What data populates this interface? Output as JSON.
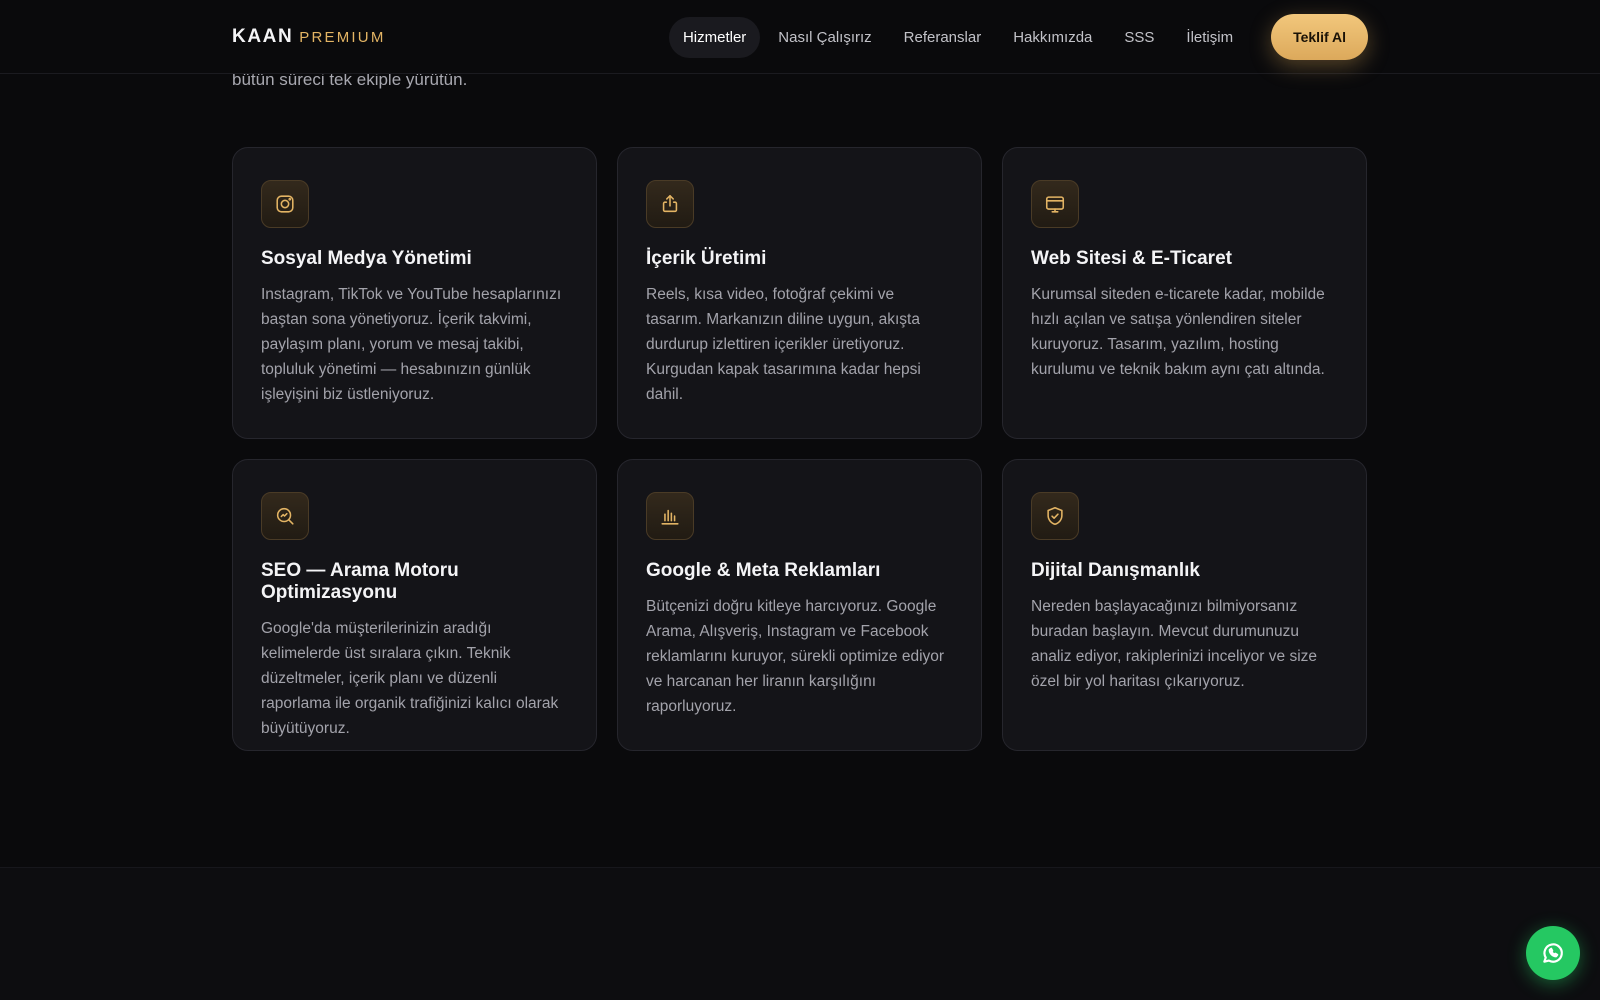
{
  "header": {
    "logo_main": "KAAN",
    "logo_accent": "PREMIUM",
    "nav": [
      {
        "label": "Hizmetler",
        "active": true
      },
      {
        "label": "Nasıl Çalışırız"
      },
      {
        "label": "Referanslar"
      },
      {
        "label": "Hakkımızda"
      },
      {
        "label": "SSS"
      },
      {
        "label": "İletişim"
      }
    ],
    "cta_label": "Teklif Al"
  },
  "intro_text": "bütün süreci tek ekiple yürütün.",
  "services": [
    {
      "icon": "instagram-icon",
      "title": "Sosyal Medya Yönetimi",
      "text": "Instagram, TikTok ve YouTube hesaplarınızı baştan sona yönetiyoruz. İçerik takvimi, paylaşım planı, yorum ve mesaj takibi, topluluk yönetimi — hesabınızın günlük işleyişini biz üstleniyoruz."
    },
    {
      "icon": "share-icon",
      "title": "İçerik Üretimi",
      "text": "Reels, kısa video, fotoğraf çekimi ve tasarım. Markanızın diline uygun, akışta durdurup izlettiren içerikler üretiyoruz. Kurgudan kapak tasarımına kadar hepsi dahil."
    },
    {
      "icon": "monitor-icon",
      "title": "Web Sitesi & E-Ticaret",
      "text": "Kurumsal siteden e-ticarete kadar, mobilde hızlı açılan ve satışa yönlendiren siteler kuruyoruz. Tasarım, yazılım, hosting kurulumu ve teknik bakım aynı çatı altında."
    },
    {
      "icon": "search-icon",
      "title": "SEO — Arama Motoru Optimizasyonu",
      "text": "Google'da müşterilerinizin aradığı kelimelerde üst sıralara çıkın. Teknik düzeltmeler, içerik planı ve düzenli raporlama ile organik trafiğinizi kalıcı olarak büyütüyoruz."
    },
    {
      "icon": "bar-chart-icon",
      "title": "Google & Meta Reklamları",
      "text": "Bütçenizi doğru kitleye harcıyoruz. Google Arama, Alışveriş, Instagram ve Facebook reklamlarını kuruyor, sürekli optimize ediyor ve harcanan her liranın karşılığını raporluyoruz."
    },
    {
      "icon": "shield-check-icon",
      "title": "Dijital Danışmanlık",
      "text": "Nereden başlayacağınızı bilmiyorsanız buradan başlayın. Mevcut durumunuzu analiz ediyor, rakiplerinizi inceliyor ve size özel bir yol haritası çıkarıyoruz."
    }
  ],
  "floating": {
    "icon": "whatsapp-icon"
  },
  "colors": {
    "accent": "#e3b464",
    "background": "#0a0a0c",
    "card": "#141418",
    "whatsapp": "#25c862"
  }
}
